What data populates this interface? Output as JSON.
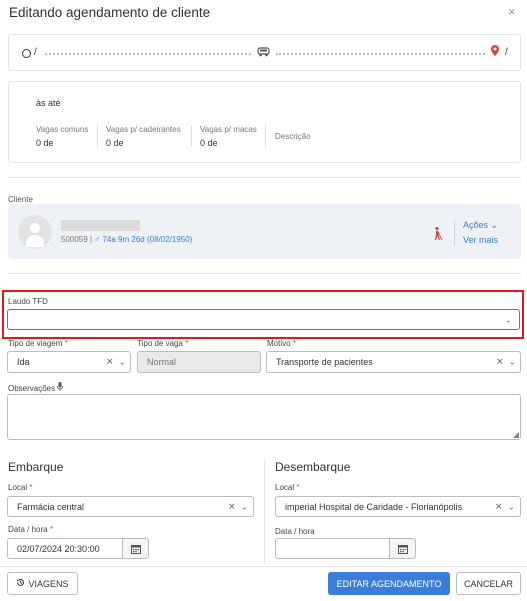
{
  "header": {
    "title": "Editando agendamento de cliente",
    "close_icon": "×"
  },
  "route": {
    "origin": "/",
    "destination": "/"
  },
  "vagas": {
    "time_text": "às até",
    "columns": [
      {
        "label": "Vagas comuns",
        "value": "0 de"
      },
      {
        "label": "Vagas p/ cadeirantes",
        "value": "0 de"
      },
      {
        "label": "Vagas p/ macas",
        "value": "0 de"
      },
      {
        "label": "Descrição",
        "value": ""
      }
    ]
  },
  "cliente": {
    "label": "Cliente",
    "id": "500059",
    "sep": "|",
    "gender_symbol": "♂",
    "age": "74a 9m 26d (08/02/1950)",
    "acoes_label": "Ações",
    "ver_mais_label": "Ver mais"
  },
  "laudo": {
    "label": "Laudo TFD",
    "value": ""
  },
  "tipo_viagem": {
    "label": "Tipo de viagem",
    "value": "Ida"
  },
  "tipo_vaga": {
    "label": "Tipo de vaga",
    "value": "Normal"
  },
  "motivo": {
    "label": "Motivo",
    "value": "Transporte de pacientes"
  },
  "observacoes": {
    "label": "Observações",
    "value": ""
  },
  "embarque": {
    "title": "Embarque",
    "local_label": "Local",
    "local_value": "Farmácia central",
    "data_label": "Data / hora",
    "data_value": "02/07/2024 20:30:00"
  },
  "desembarque": {
    "title": "Desembarque",
    "local_label": "Local",
    "local_value": "imperial Hospital de Caridade - Florianópolis",
    "data_label": "Data / hora",
    "data_value": ""
  },
  "footer": {
    "viagens_label": "VIAGENS",
    "editar_label": "EDITAR AGENDAMENTO",
    "cancelar_label": "CANCELAR"
  },
  "colors": {
    "primary": "#3b7dd8",
    "danger": "#d64541",
    "highlight": "#e01a1a"
  }
}
